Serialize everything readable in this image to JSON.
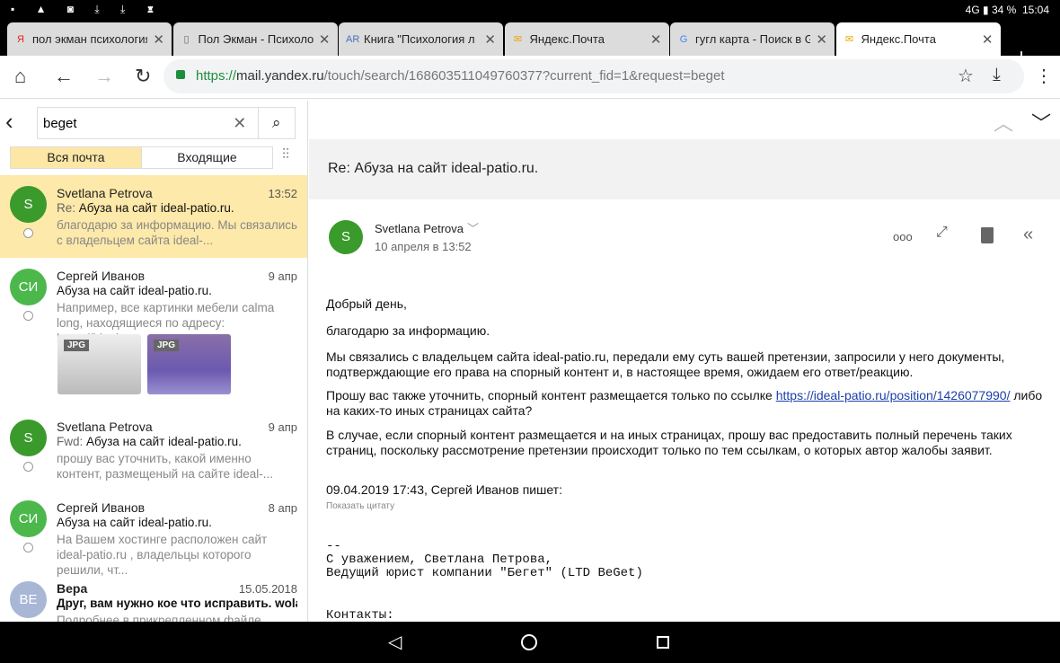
{
  "status": {
    "left_icons": "▪ ▲ ◙ ⤓ ⤓ ♜",
    "signal": "4G",
    "battery": "34 %",
    "time": "15:04"
  },
  "tabs": [
    {
      "label": "пол экман психология",
      "fav": "Я",
      "favcolor": "#e52620"
    },
    {
      "label": "Пол Экман - Психология",
      "fav": "▯",
      "favcolor": "#666"
    },
    {
      "label": "Книга \"Психология л",
      "fav": "AR",
      "favcolor": "#4a6fb5"
    },
    {
      "label": "Яндекс.Почта",
      "fav": "✉",
      "favcolor": "#e8a600"
    },
    {
      "label": "гугл карта - Поиск в G",
      "fav": "G",
      "favcolor": "#4285f4"
    },
    {
      "label": "Яндекс.Почта",
      "fav": "✉",
      "favcolor": "#e8a600"
    }
  ],
  "url": {
    "scheme": "https://",
    "host": "mail.yandex.ru",
    "path": "/touch/search/168603511049760377?current_fid=1&request=beget"
  },
  "search": {
    "value": "beget"
  },
  "filters": {
    "all": "Вся почта",
    "inbox": "Входящие"
  },
  "list": [
    {
      "initials": "S",
      "color": "#3a9a2b",
      "from": "Svetlana Petrova",
      "date": "13:52",
      "prefix": "Re: ",
      "subject": "Абуза на сайт ideal-patio.ru.",
      "snippet": "благодарю за информацию. Мы связались с владельцем сайта ideal-..."
    },
    {
      "initials": "СИ",
      "color": "#4cb84c",
      "from": "Сергей Иванов",
      "date": "9 апр",
      "prefix": "",
      "subject": "Абуза на сайт ideal-patio.ru.",
      "snippet": "Например, все картинки мебели calma long, находящиеся по адресу: https://ideal...",
      "attachments": [
        "JPG",
        "JPG"
      ]
    },
    {
      "initials": "S",
      "color": "#3a9a2b",
      "from": "Svetlana Petrova",
      "date": "9 апр",
      "prefix": "Fwd: ",
      "subject": "Абуза на сайт ideal-patio.ru.",
      "snippet": "прошу вас уточнить, какой именно контент, размещеный на сайте ideal-..."
    },
    {
      "initials": "СИ",
      "color": "#4cb84c",
      "from": "Сергей Иванов",
      "date": "8 апр",
      "prefix": "",
      "subject": "Абуза на сайт ideal-patio.ru.",
      "snippet": "На Вашем хостинге расположен сайт ideal-patio.ru , владельцы которого решили, чт..."
    },
    {
      "initials": "ВЕ",
      "color": "#a9b7d6",
      "from": "Вера",
      "date": "15.05.2018",
      "prefix": "",
      "subject": "Друг, вам нужно кое что исправить. wolan...",
      "snippet": "Подробнее в прикрепленном файле."
    }
  ],
  "message": {
    "subject": "Re: Абуза на сайт ideal-patio.ru.",
    "sender": "Svetlana Petrova",
    "initial": "S",
    "date": "10 апреля в 13:52",
    "p1": "Добрый день,",
    "p2": "благодарю за информацию.",
    "p3": "Мы связались с владельцем сайта ideal-patio.ru, передали ему суть вашей претензии, запросили у него документы, подтверждающие его права на спорный контент и, в настоящее время, ожидаем его ответ/реакцию.",
    "p4a": "Прошу вас также уточнить, спорный контент размещается только по ссылке ",
    "p4link": "https://ideal-patio.ru/position/1426077990/",
    "p4b": " либо на каких-то иных страницах сайта?",
    "p5": "В случае, если спорный контент размещается и на иных страницах, прошу вас предоставить полный перечень таких страниц, поскольку рассмотрение претензии происходит только по тем ссылкам, о которых автор жалобы заявит.",
    "quote_header": "09.04.2019 17:43, Сергей Иванов пишет:",
    "show_quote": "Показать цитату",
    "sig1": "--",
    "sig2": "С уважением, Светлана Петрова,",
    "sig3": "Ведущий юрист компании \"Бегет\" (LTD BeGet)",
    "sig4": "Контакты:"
  }
}
